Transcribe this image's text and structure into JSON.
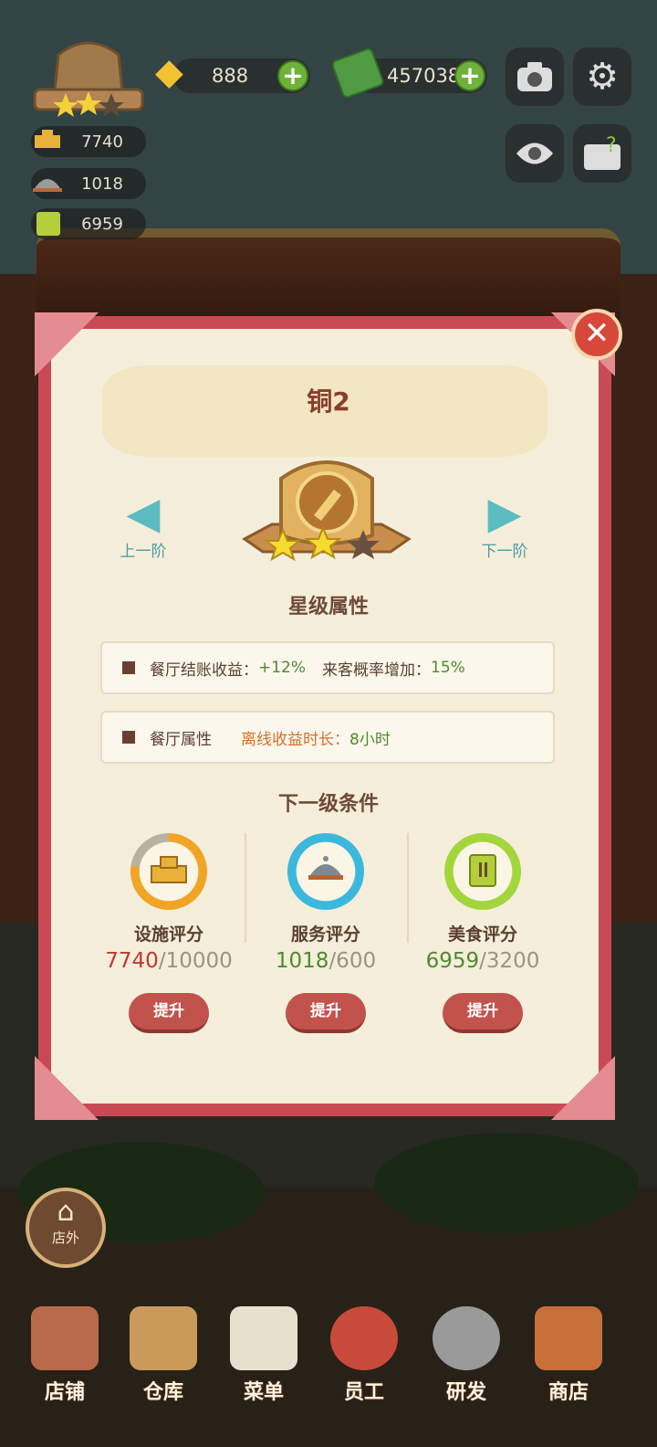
{
  "hud": {
    "gems": "888",
    "cash": "457038",
    "facility_score": "7740",
    "service_score": "1018",
    "food_score": "6959"
  },
  "modal": {
    "title": "铜2",
    "prev_label": "上一阶",
    "next_label": "下一阶",
    "star_section": "星级属性",
    "attr1_label": "餐厅结账收益：",
    "attr1_value": "+12%",
    "attr1_label2": "来客概率增加：",
    "attr1_value2": "15%",
    "attr2_label": "餐厅属性",
    "attr2_key": "离线收益时长：",
    "attr2_value": "8小时",
    "next_section": "下一级条件",
    "conditions": [
      {
        "label": "设施评分",
        "current": "7740",
        "target": "/10000",
        "button": "提升",
        "progress": 0.774,
        "color": "#f0a526"
      },
      {
        "label": "服务评分",
        "current": "1018",
        "target": "/600",
        "button": "提升",
        "progress": 1.0,
        "color": "#3cb8dd"
      },
      {
        "label": "美食评分",
        "current": "6959",
        "target": "/3200",
        "button": "提升",
        "progress": 1.0,
        "color": "#a3d63c"
      }
    ]
  },
  "outside_label": "店外",
  "bottom_nav": [
    "店铺",
    "仓库",
    "菜单",
    "员工",
    "研发",
    "商店"
  ],
  "colors": {
    "modal_border": "#c94a55",
    "current_red": "#c0392b",
    "current_green": "#4f8a2e"
  }
}
